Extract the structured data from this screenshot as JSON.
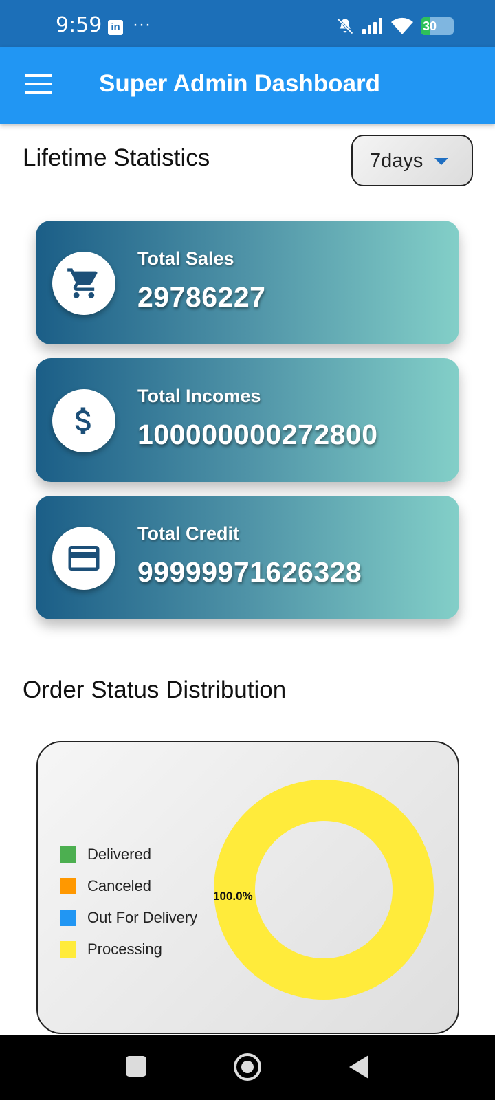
{
  "status_bar": {
    "time": "9:59",
    "notification_app": "in",
    "more_dots": "···",
    "battery_level": "30",
    "battery_percent": 30
  },
  "app_bar": {
    "title": "Super Admin Dashboard",
    "background_color": "#2196f3"
  },
  "lifetime": {
    "heading": "Lifetime Statistics",
    "period_selected": "7days"
  },
  "stats": [
    {
      "label": "Total Sales",
      "value": "29786227",
      "icon": "cart-icon"
    },
    {
      "label": "Total Incomes",
      "value": "100000000272800",
      "icon": "dollar-icon"
    },
    {
      "label": "Total Credit",
      "value": "99999971626328",
      "icon": "credit-card-icon"
    }
  ],
  "order_status": {
    "heading": "Order Status Distribution"
  },
  "chart_data": {
    "type": "pie",
    "categories": [
      "Delivered",
      "Canceled",
      "Out For Delivery",
      "Processing"
    ],
    "values": [
      0,
      0,
      0,
      100
    ],
    "colors": [
      "#4caf50",
      "#ff9800",
      "#2196f3",
      "#ffeb3b"
    ],
    "slice_labels": [
      "100.0%"
    ],
    "donut": true,
    "legend_placement": "left"
  }
}
